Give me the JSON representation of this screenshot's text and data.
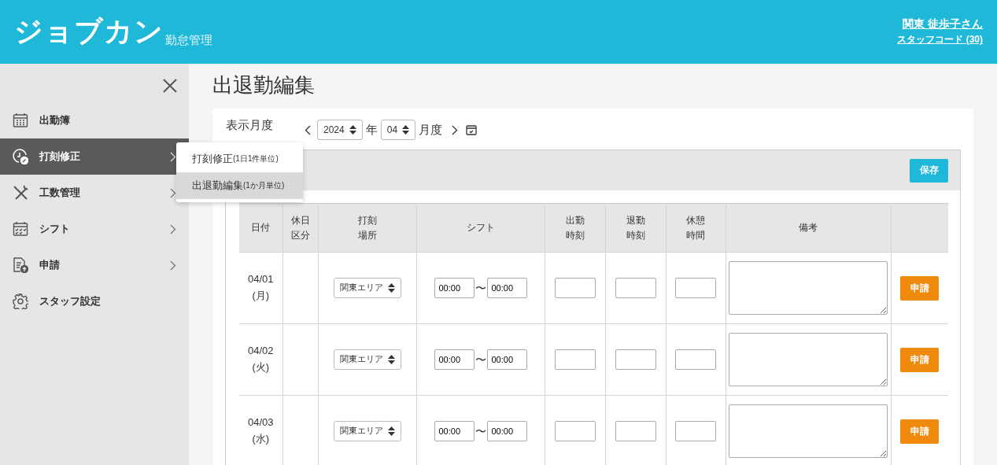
{
  "header": {
    "logo": "ジョブカン",
    "subtitle": "勤怠管理",
    "user_name": "関東 徒歩子さん",
    "staff_code": "スタッフコード (30)"
  },
  "sidebar": {
    "items": [
      {
        "kind": "attendance",
        "label": "出勤簿",
        "selected": false,
        "submenu": false
      },
      {
        "kind": "clock-edit",
        "label": "打刻修正",
        "selected": true,
        "submenu": true
      },
      {
        "kind": "tools",
        "label": "工数管理",
        "selected": false,
        "submenu": true
      },
      {
        "kind": "shift",
        "label": "シフト",
        "selected": false,
        "submenu": true
      },
      {
        "kind": "request",
        "label": "申請",
        "selected": false,
        "submenu": true
      },
      {
        "kind": "settings",
        "label": "スタッフ設定",
        "selected": false,
        "submenu": false
      }
    ]
  },
  "flyout_menu": {
    "items": [
      {
        "label": "打刻修正",
        "note": "(1日1件単位)",
        "selected": false
      },
      {
        "label": "出退勤編集",
        "note": "(1か月単位)",
        "selected": true
      }
    ]
  },
  "page_title": "出退勤編集",
  "month_selector": {
    "label": "表示月度",
    "year": "2024",
    "year_unit": "年",
    "month": "04",
    "month_unit": "月度"
  },
  "save_button": "保存",
  "table": {
    "columns": [
      [
        "日付"
      ],
      [
        "休日",
        "区分"
      ],
      [
        "打刻",
        "場所"
      ],
      [
        "シフト"
      ],
      [
        "出勤",
        "時刻"
      ],
      [
        "退勤",
        "時刻"
      ],
      [
        "休憩",
        "時間"
      ],
      [
        "備考"
      ]
    ],
    "rows": [
      {
        "date": "04/01",
        "weekday": "(月)",
        "location": "関東エリア",
        "shift_start": "00:00",
        "shift_separator": "〜",
        "shift_end": "00:00",
        "apply_button": "申請"
      },
      {
        "date": "04/02",
        "weekday": "(火)",
        "location": "関東エリア",
        "shift_start": "00:00",
        "shift_separator": "〜",
        "shift_end": "00:00",
        "apply_button": "申請"
      },
      {
        "date": "04/03",
        "weekday": "(水)",
        "location": "関東エリア",
        "shift_start": "00:00",
        "shift_separator": "〜",
        "shift_end": "00:00",
        "apply_button": "申請"
      }
    ]
  }
}
